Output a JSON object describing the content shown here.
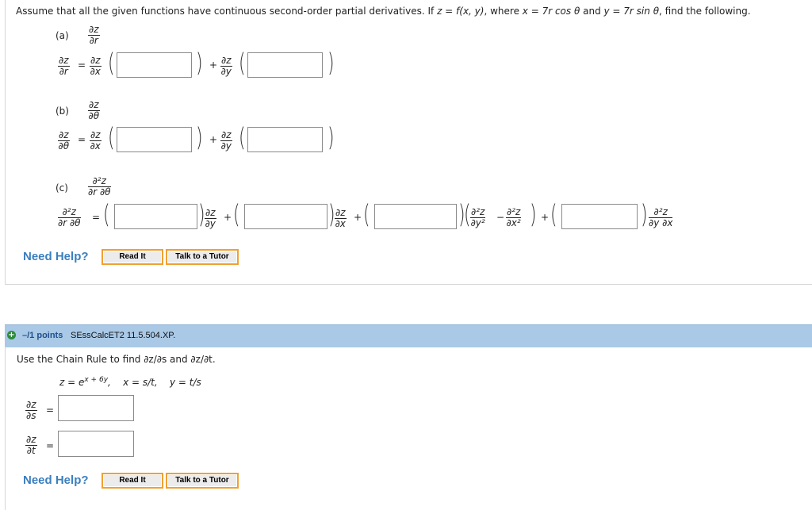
{
  "q1": {
    "prompt_parts": [
      "Assume that all the given functions have continuous second-order partial derivatives. If ",
      "z = f(x, y)",
      ", where ",
      "x = 7r cos θ",
      " and ",
      "y = 7r sin θ",
      ", find the following."
    ],
    "a": {
      "label": "(a)",
      "target": {
        "num": "∂z",
        "den": "∂r"
      },
      "lhs": {
        "num": "∂z",
        "den": "∂r"
      },
      "eq": "=",
      "t1": {
        "num": "∂z",
        "den": "∂x"
      },
      "plus": "+",
      "t2": {
        "num": "∂z",
        "den": "∂y"
      }
    },
    "b": {
      "label": "(b)",
      "target": {
        "num": "∂z",
        "den": "∂θ"
      },
      "lhs": {
        "num": "∂z",
        "den": "∂θ"
      },
      "eq": "=",
      "t1": {
        "num": "∂z",
        "den": "∂x"
      },
      "plus": "+",
      "t2": {
        "num": "∂z",
        "den": "∂y"
      }
    },
    "c": {
      "label": "(c)",
      "target": {
        "num": "∂²z",
        "den": "∂r ∂θ"
      },
      "lhs": {
        "num": "∂²z",
        "den": "∂r ∂θ"
      },
      "eq": "=",
      "f1": {
        "num": "∂z",
        "den": "∂y"
      },
      "f2": {
        "num": "∂z",
        "den": "∂x"
      },
      "f3a": {
        "num": "∂²z",
        "den": "∂y²"
      },
      "minus": "−",
      "f3b": {
        "num": "∂²z",
        "den": "∂x²"
      },
      "f4": {
        "num": "∂²z",
        "den": "∂y ∂x"
      },
      "plus": "+"
    },
    "help_label": "Need Help?",
    "read_it": "Read It",
    "talk_tutor": "Talk to a Tutor"
  },
  "q2": {
    "header": {
      "icon": "plus-circle-icon",
      "points": "–/1 points",
      "code": "SEssCalcET2 11.5.504.XP."
    },
    "prompt": "Use the Chain Rule to find ∂z/∂s and ∂z/∂t.",
    "formula": {
      "z_base": "z = e",
      "z_exp": "x + 6y",
      "rest": ",    x = s/t,    y = t/s"
    },
    "rows": [
      {
        "num": "∂z",
        "den": "∂s",
        "eq": "="
      },
      {
        "num": "∂z",
        "den": "∂t",
        "eq": "="
      }
    ],
    "help_label": "Need Help?",
    "read_it": "Read It",
    "talk_tutor": "Talk to a Tutor"
  },
  "colors": {
    "help": "#3a7fbf",
    "header_bg": "#a9c9e6",
    "button_outline": "#f0a030"
  }
}
